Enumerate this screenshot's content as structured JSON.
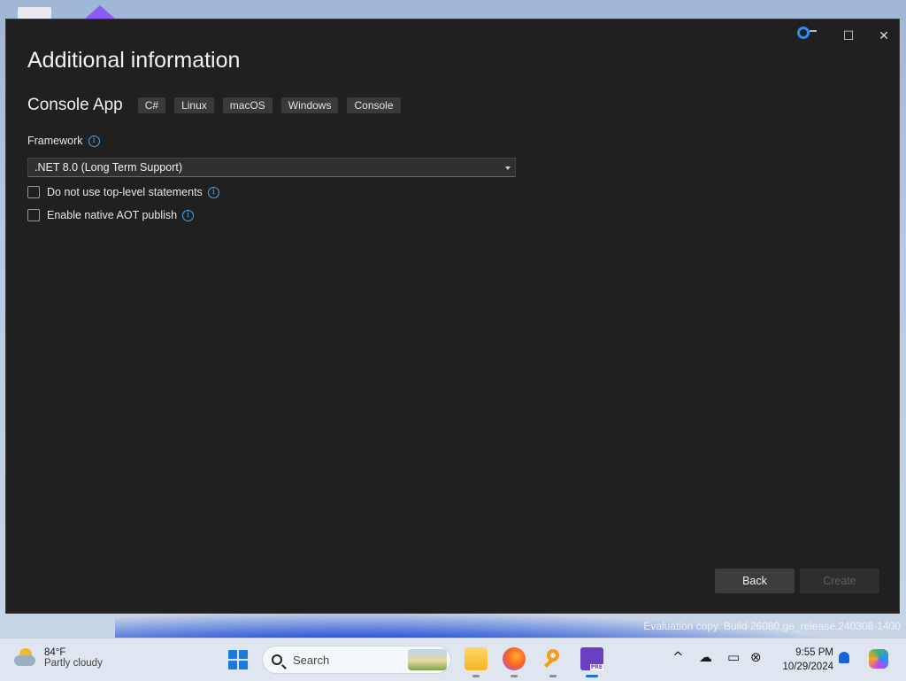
{
  "dialog": {
    "title": "Additional information",
    "template_name": "Console App",
    "tags": [
      "C#",
      "Linux",
      "macOS",
      "Windows",
      "Console"
    ],
    "framework_label": "Framework",
    "framework_value": ".NET 8.0 (Long Term Support)",
    "options": [
      {
        "label": "Do not use top-level statements",
        "checked": false
      },
      {
        "label": "Enable native AOT publish",
        "checked": false
      }
    ],
    "back_label": "Back",
    "create_label": "Create",
    "window_controls": {
      "maximize": "☐",
      "close": "✕"
    }
  },
  "desktop": {
    "eval_text": "Evaluation copy. Build 26080.ge_release.240308-1400"
  },
  "taskbar": {
    "weather_temp": "84°F",
    "weather_desc": "Partly cloudy",
    "search_placeholder": "Search",
    "apps": [
      "file-explorer",
      "firefox",
      "magnifier",
      "visual-studio-preview"
    ],
    "tray_chevron": "^",
    "time": "9:55 PM",
    "date": "10/29/2024"
  },
  "colors": {
    "accent": "#2e8df0",
    "dialog_bg": "#202020",
    "info": "#4aa3e8"
  }
}
